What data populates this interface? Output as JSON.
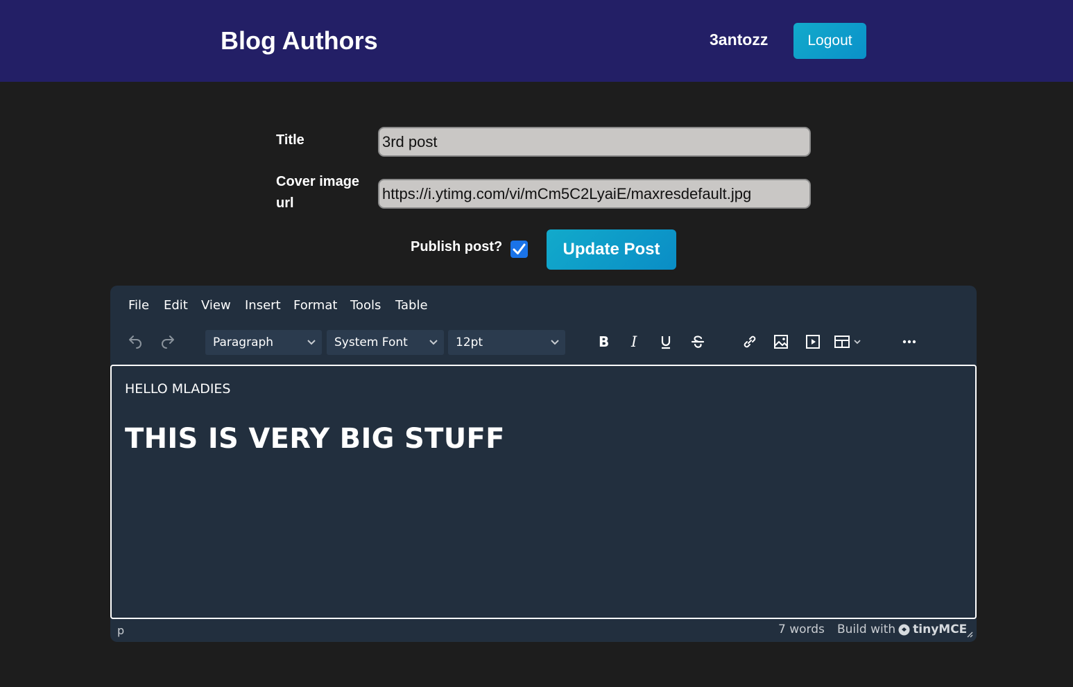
{
  "header": {
    "brand": "Blog Authors",
    "username": "3antozz",
    "logout_label": "Logout"
  },
  "form": {
    "title_label": "Title",
    "title_value": "3rd post",
    "cover_label_line1": "Cover image",
    "cover_label_line2": "url",
    "cover_value": "https://i.ytimg.com/vi/mCm5C2LyaiE/maxresdefault.jpg",
    "publish_label": "Publish post?",
    "publish_checked": true,
    "update_label": "Update Post"
  },
  "editor": {
    "menu": [
      "File",
      "Edit",
      "View",
      "Insert",
      "Format",
      "Tools",
      "Table"
    ],
    "block_format": "Paragraph",
    "font_family": "System Font",
    "font_size": "12pt",
    "content": {
      "paragraph": "HELLO MLADIES",
      "heading": "THIS IS VERY BIG STUFF"
    },
    "status": {
      "path": "p",
      "word_count": "7 words",
      "build_with": "Build with",
      "brand": "tinyMCE"
    }
  },
  "colors": {
    "header_bg": "#231f66",
    "page_bg": "#1d1d1d",
    "editor_bg": "#222f3e",
    "accent": "#12aacb",
    "checkbox": "#1a73e8"
  }
}
